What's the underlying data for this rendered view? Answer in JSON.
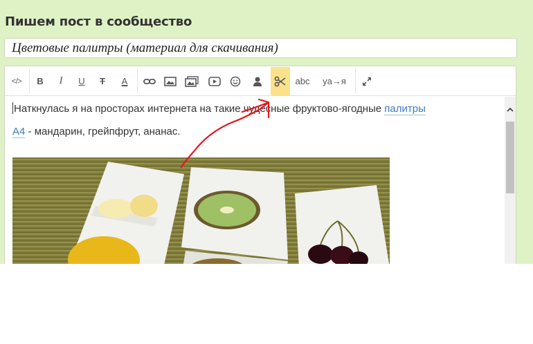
{
  "page": {
    "heading": "Пишем пост в сообщество"
  },
  "title_input": {
    "value": "Цветовые палитры (материал для скачивания)"
  },
  "toolbar": {
    "source_label": "</>",
    "bold_label": "B",
    "italic_label": "I",
    "underline_label": "U",
    "strike_label": "T",
    "color_label": "A",
    "spellcheck_label": "abc",
    "translit_label": "ya→я",
    "icons": {
      "source": "code-icon",
      "link": "link-icon",
      "image": "image-icon",
      "gallery": "gallery-icon",
      "video": "video-icon",
      "emoji": "smiley-icon",
      "user": "user-icon",
      "cut": "scissors-icon",
      "fullscreen": "expand-icon"
    },
    "active_tool": "cut",
    "active_color": "#fbe28a"
  },
  "body": {
    "line1_text": "Наткнулась я на просторах интернета на такие чудесные фруктово-ягодные ",
    "line1_link": "палитры",
    "line2_link": "А4",
    "line2_text": " - мандарин, грейпфрут, ананас."
  },
  "colors": {
    "panel_bg": "#dff2c5",
    "link": "#3b7bbf",
    "annotation": "#e8141b"
  }
}
